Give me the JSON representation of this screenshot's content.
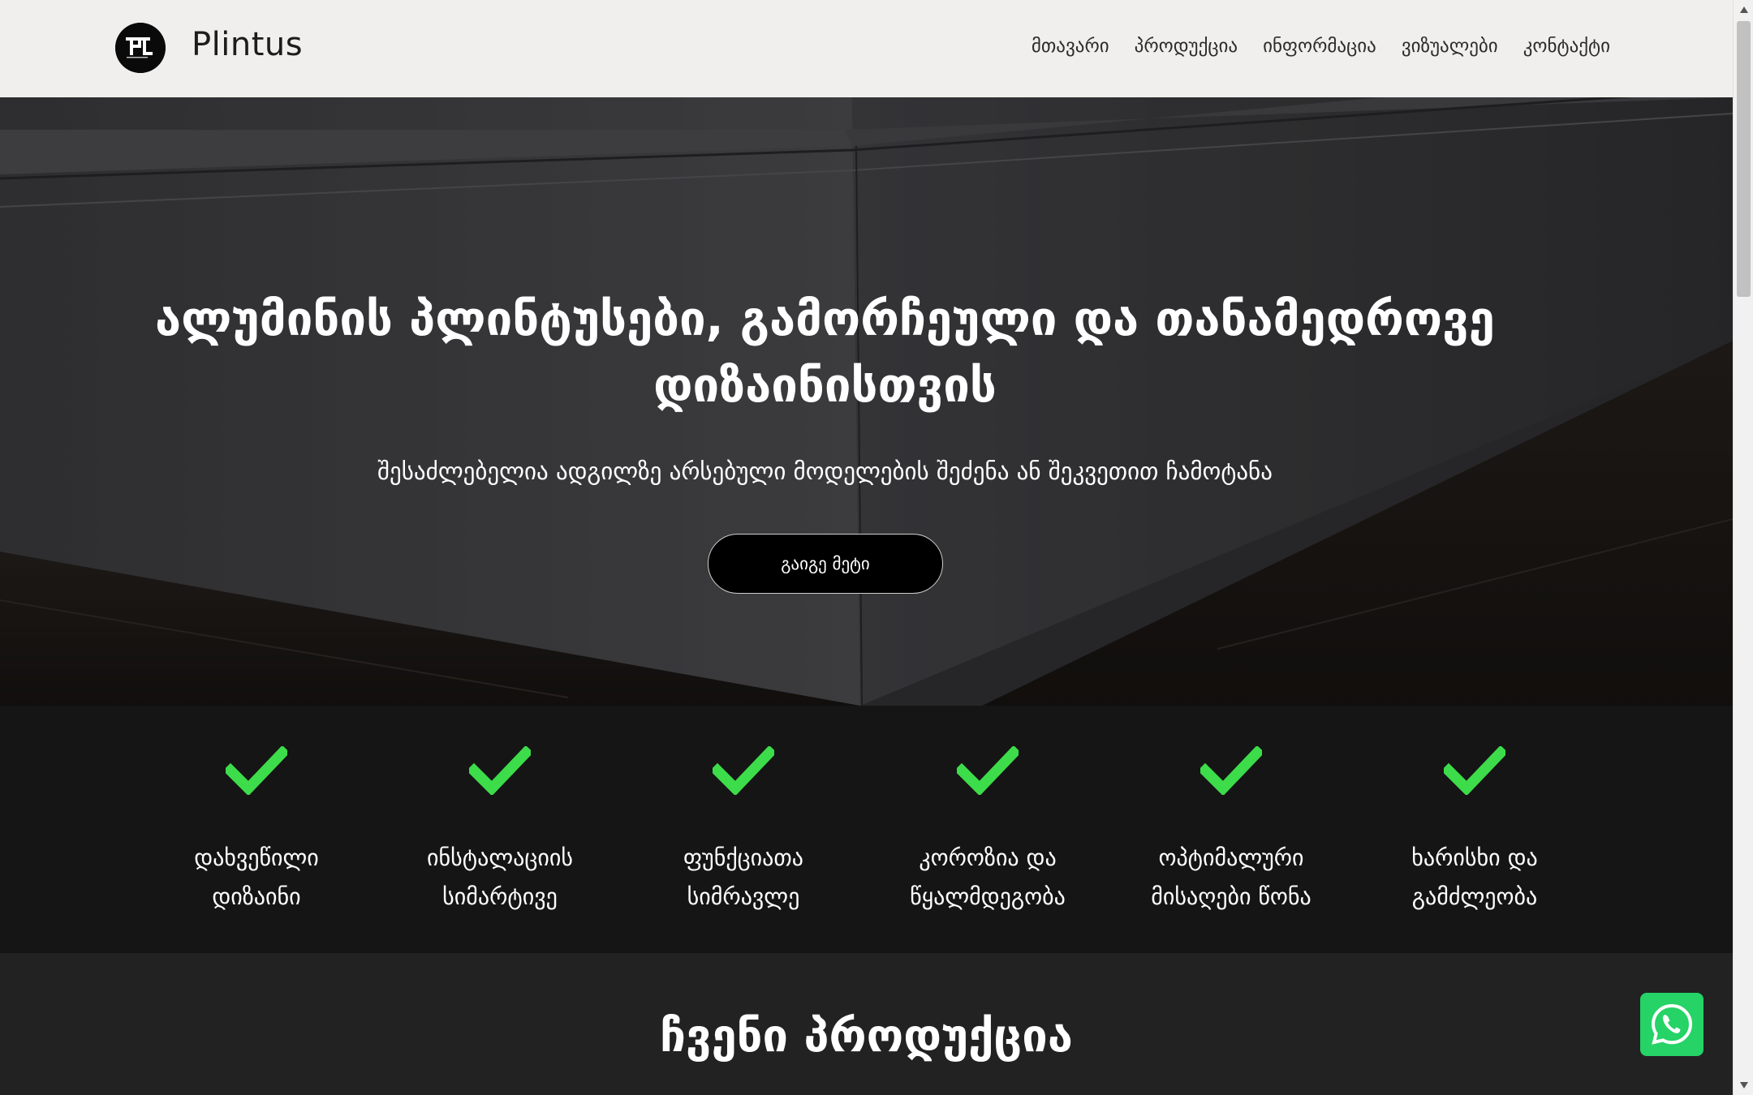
{
  "header": {
    "brand": "Plintus",
    "logo_text": "PL",
    "nav": [
      "მთავარი",
      "პროდუქცია",
      "ინფორმაცია",
      "ვიზუალები",
      "კონტაქტი"
    ]
  },
  "hero": {
    "title": "ალუმინის პლინტუსები, გამორჩეული და თანამედროვე დიზაინისთვის",
    "subtitle": "შესაძლებელია ადგილზე არსებული მოდელების შეძენა ან შეკვეთით ჩამოტანა",
    "cta_label": "გაიგე მეტი"
  },
  "features": [
    {
      "label": "დახვეწილი დიზაინი",
      "icon": "check-icon"
    },
    {
      "label": "ინსტალაციის სიმარტივე",
      "icon": "check-icon"
    },
    {
      "label": "ფუნქციათა სიმრავლე",
      "icon": "check-icon"
    },
    {
      "label": "კოროზია და წყალმდეგობა",
      "icon": "check-icon"
    },
    {
      "label": "ოპტიმალური მისაღები წონა",
      "icon": "check-icon"
    },
    {
      "label": "ხარისხი და გამძლეობა",
      "icon": "check-icon"
    }
  ],
  "products": {
    "heading": "ჩვენი პროდუქცია"
  },
  "colors": {
    "header_bg": "#f1efed",
    "check_green": "#3ddc4a",
    "whatsapp_green": "#25d366",
    "features_bg": "#151515"
  }
}
